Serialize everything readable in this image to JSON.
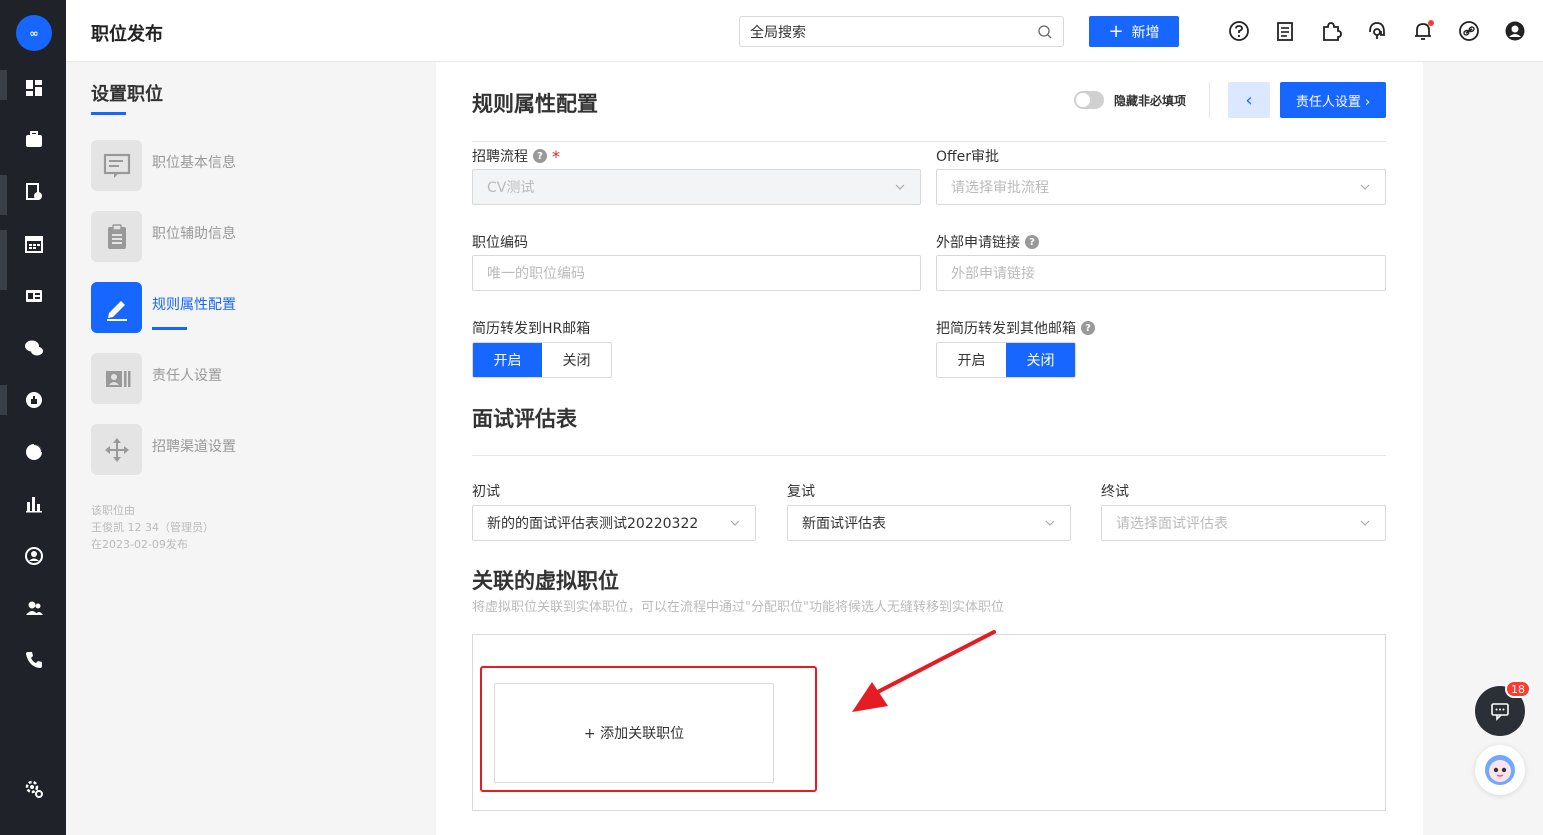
{
  "colors": {
    "primary": "#1766ff",
    "rail_bg": "#1f2329",
    "danger": "#e51c23"
  },
  "rail": {
    "logo_text": "∞",
    "icons": [
      "dashboard-icon",
      "briefcase-icon",
      "resume-icon",
      "calendar-icon",
      "id-card-icon",
      "wechat-icon",
      "thumbs-up-icon",
      "pie-chart-icon",
      "bar-chart-icon",
      "person-circle-icon",
      "team-icon",
      "phone-icon",
      "settings-gear-icon"
    ]
  },
  "header": {
    "title": "职位发布",
    "search_placeholder": "全局搜索",
    "add_label": "新增",
    "icons": [
      "help-icon",
      "document-icon",
      "puzzle-icon",
      "support-icon",
      "bell-icon",
      "link-icon",
      "account-icon"
    ]
  },
  "steps": {
    "heading": "设置职位",
    "items": [
      {
        "label": "职位基本信息",
        "icon": "form-icon"
      },
      {
        "label": "职位辅助信息",
        "icon": "clipboard-icon"
      },
      {
        "label": "规则属性配置",
        "icon": "edit-pencil-icon",
        "active": true
      },
      {
        "label": "责任人设置",
        "icon": "contact-card-icon"
      },
      {
        "label": "招聘渠道设置",
        "icon": "move-arrows-icon"
      }
    ],
    "meta_line1": "该职位由",
    "meta_line2": "王俊凯 12 34（管理员）",
    "meta_line3": "在2023-02-09发布"
  },
  "rules": {
    "title": "规则属性配置",
    "hide_optional_label": "隐藏非必填项",
    "prev_icon": "‹",
    "next_label": "责任人设置 ›",
    "recruit_flow": {
      "label": "招聘流程",
      "required": "*",
      "value": "CV测试"
    },
    "offer_approval": {
      "label": "Offer审批",
      "placeholder": "请选择审批流程"
    },
    "job_code": {
      "label": "职位编码",
      "placeholder": "唯一的职位编码"
    },
    "external_link": {
      "label": "外部申请链接",
      "placeholder": "外部申请链接"
    },
    "forward_hr": {
      "label": "简历转发到HR邮箱",
      "on": "开启",
      "off": "关闭",
      "selected": "on"
    },
    "forward_other": {
      "label": "把简历转发到其他邮箱",
      "on": "开启",
      "off": "关闭",
      "selected": "off"
    }
  },
  "interview": {
    "title": "面试评估表",
    "first": {
      "label": "初试",
      "value": "新的的面试评估表测试20220322"
    },
    "second": {
      "label": "复试",
      "value": "新面试评估表"
    },
    "final": {
      "label": "终试",
      "placeholder": "请选择面试评估表"
    }
  },
  "virtual": {
    "title": "关联的虚拟职位",
    "description": "将虚拟职位关联到实体职位，可以在流程中通过\"分配职位\"功能将候选人无缝转移到实体职位",
    "add_label": "+ 添加关联职位"
  },
  "chat": {
    "badge": "18"
  }
}
